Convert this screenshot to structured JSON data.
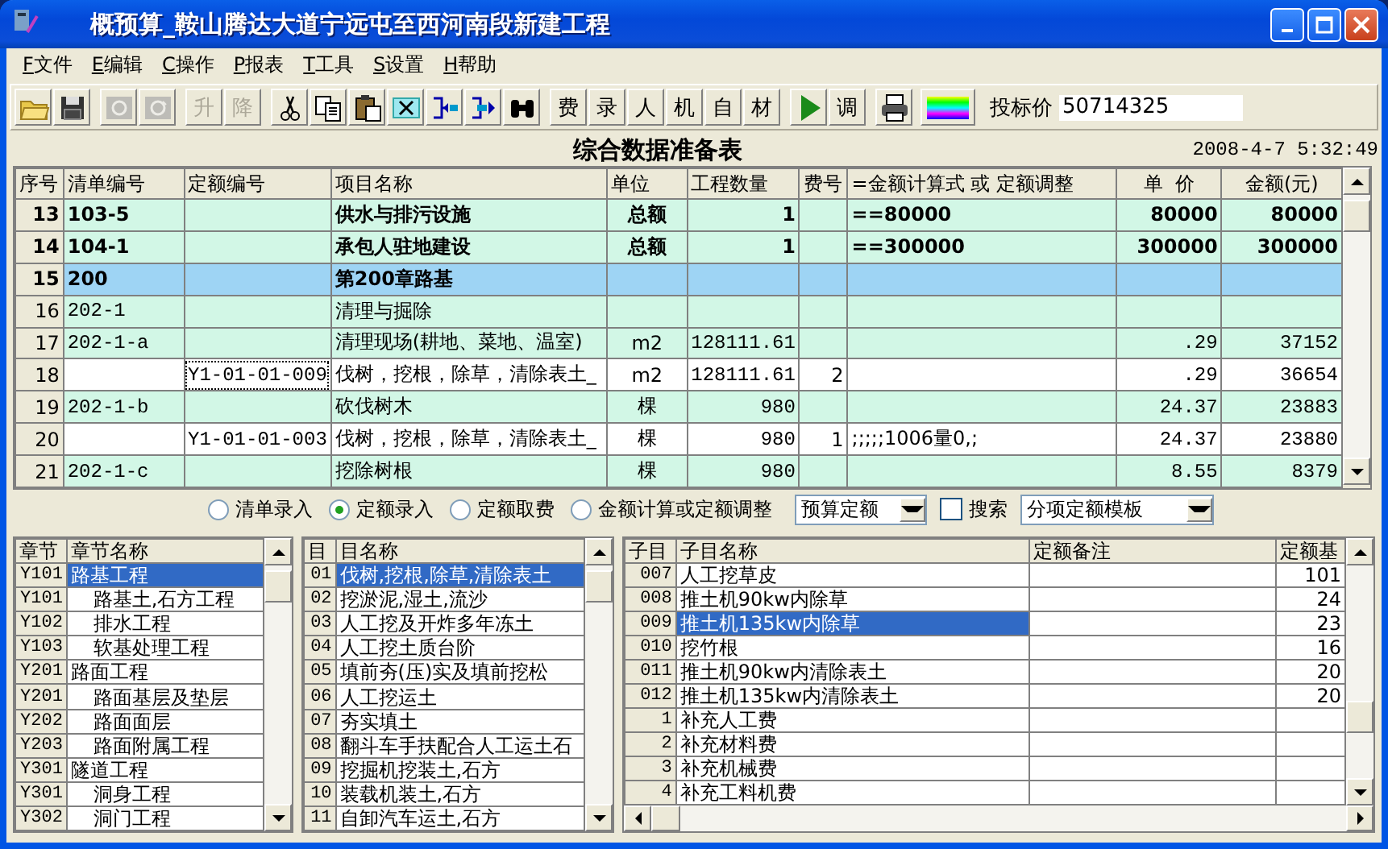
{
  "window": {
    "title": "概预算_鞍山腾达大道宁远屯至西河南段新建工程"
  },
  "menu": [
    {
      "label": "F文件"
    },
    {
      "label": "E编辑"
    },
    {
      "label": "C操作"
    },
    {
      "label": "P报表"
    },
    {
      "label": "T工具"
    },
    {
      "label": "S设置"
    },
    {
      "label": "H帮助"
    }
  ],
  "toolbar": [
    {
      "kind": "icon",
      "disabled": false
    },
    {
      "kind": "icon",
      "disabled": false
    },
    {
      "kind": "icon",
      "disabled": true
    },
    {
      "kind": "icon",
      "disabled": true
    },
    {
      "kind": "text",
      "label": "升",
      "disabled": true
    },
    {
      "kind": "text",
      "label": "降",
      "disabled": true
    },
    {
      "kind": "icon",
      "disabled": false
    },
    {
      "kind": "icon",
      "disabled": false
    },
    {
      "kind": "icon",
      "disabled": false
    },
    {
      "kind": "icon",
      "disabled": false
    },
    {
      "kind": "icon",
      "disabled": false
    },
    {
      "kind": "icon",
      "disabled": false
    },
    {
      "kind": "icon",
      "disabled": false
    },
    {
      "kind": "text",
      "label": "费",
      "disabled": false
    },
    {
      "kind": "text",
      "label": "录",
      "disabled": false
    },
    {
      "kind": "text",
      "label": "人",
      "disabled": false
    },
    {
      "kind": "text",
      "label": "机",
      "disabled": false
    },
    {
      "kind": "text",
      "label": "自",
      "disabled": false
    },
    {
      "kind": "text",
      "label": "材",
      "disabled": false
    },
    {
      "kind": "icon",
      "disabled": false
    },
    {
      "kind": "text",
      "label": "调",
      "disabled": false
    },
    {
      "kind": "icon",
      "disabled": false
    },
    {
      "kind": "icon",
      "disabled": false
    }
  ],
  "bid_price": {
    "label": "投标价",
    "value": "50714325"
  },
  "sheet": {
    "title": "综合数据准备表",
    "timestamp": "2008-4-7 5:32:49"
  },
  "table": {
    "columns": [
      "序号",
      "清单编号",
      "定额编号",
      "项目名称",
      "单位",
      "工程数量",
      "费号",
      "=金额计算式 或 定额调整",
      "单  价",
      "金额(元)"
    ],
    "rows": [
      {
        "kind": "item",
        "focused": false,
        "no": "13",
        "bill_code": "103-5",
        "name": "供水与排污设施",
        "unit": "总额",
        "quantity": "1",
        "formula": "==80000",
        "unit_price": "80000",
        "amount": "80000"
      },
      {
        "kind": "item",
        "focused": false,
        "no": "14",
        "bill_code": "104-1",
        "name": "承包人驻地建设",
        "unit": "总额",
        "quantity": "1",
        "formula": "==300000",
        "unit_price": "300000",
        "amount": "300000"
      },
      {
        "kind": "chapter",
        "focused": false,
        "no": "15",
        "bill_code": "200",
        "name": "第200章路基"
      },
      {
        "kind": "bill",
        "focused": false,
        "no": "16",
        "bill_code": "202-1",
        "name": "清理与掘除"
      },
      {
        "kind": "bill",
        "focused": false,
        "no": "17",
        "bill_code": "202-1-a",
        "name": "清理现场(耕地、菜地、温室)",
        "unit": "m2",
        "quantity": "128111.61",
        "unit_price": ".29",
        "amount": "37152"
      },
      {
        "kind": "quota",
        "focused": true,
        "no": "18",
        "quota_code": "Y1-01-01-009",
        "name": "伐树，挖根，除草，清除表土_",
        "unit": "m2",
        "quantity": "128111.61",
        "fee_no": "2",
        "unit_price": ".29",
        "amount": "36654"
      },
      {
        "kind": "bill",
        "focused": false,
        "no": "19",
        "bill_code": "202-1-b",
        "name": "砍伐树木",
        "unit": "棵",
        "quantity": "980",
        "unit_price": "24.37",
        "amount": "23883"
      },
      {
        "kind": "quota",
        "focused": false,
        "no": "20",
        "quota_code": "Y1-01-01-003",
        "name": "伐树，挖根，除草，清除表土_",
        "unit": "棵",
        "quantity": "980",
        "fee_no": "1",
        "formula": ";;;;;1006量0,;",
        "unit_price": "24.37",
        "amount": "23880"
      },
      {
        "kind": "bill",
        "focused": false,
        "no": "21",
        "bill_code": "202-1-c",
        "name": "挖除树根",
        "unit": "棵",
        "quantity": "980",
        "unit_price": "8.55",
        "amount": "8379"
      }
    ]
  },
  "entry_modes": [
    {
      "label": "清单录入",
      "selected": false
    },
    {
      "label": "定额录入",
      "selected": true
    },
    {
      "label": "定额取费",
      "selected": false
    },
    {
      "label": "金额计算或定额调整",
      "selected": false
    }
  ],
  "quota_book": {
    "value": "预算定额"
  },
  "search": {
    "label": "搜索",
    "checked": false
  },
  "template": {
    "value": "分项定额模板"
  },
  "chapters": {
    "columns": [
      "章节",
      "章节名称"
    ],
    "items": [
      {
        "code": "Y101",
        "name": "路基工程",
        "selected": true,
        "children": [
          {
            "code": "Y101",
            "name": "路基土,石方工程",
            "selected": false
          },
          {
            "code": "Y102",
            "name": "排水工程",
            "selected": false
          },
          {
            "code": "Y103",
            "name": "软基处理工程",
            "selected": false
          }
        ]
      },
      {
        "code": "Y201",
        "name": "路面工程",
        "selected": false,
        "children": [
          {
            "code": "Y201",
            "name": "路面基层及垫层",
            "selected": false
          },
          {
            "code": "Y202",
            "name": "路面面层",
            "selected": false
          },
          {
            "code": "Y203",
            "name": "路面附属工程",
            "selected": false
          }
        ]
      },
      {
        "code": "Y301",
        "name": "隧道工程",
        "selected": false,
        "children": [
          {
            "code": "Y301",
            "name": "洞身工程",
            "selected": false
          },
          {
            "code": "Y302",
            "name": "洞门工程",
            "selected": false
          }
        ]
      }
    ]
  },
  "sections": {
    "columns": [
      "目",
      "目名称"
    ],
    "items": [
      {
        "code": "01",
        "name": "伐树,挖根,除草,清除表土",
        "selected": true
      },
      {
        "code": "02",
        "name": "挖淤泥,湿土,流沙",
        "selected": false
      },
      {
        "code": "03",
        "name": "人工挖及开炸多年冻土",
        "selected": false
      },
      {
        "code": "04",
        "name": "人工挖土质台阶",
        "selected": false
      },
      {
        "code": "05",
        "name": "填前夯(压)实及填前挖松",
        "selected": false
      },
      {
        "code": "06",
        "name": "人工挖运土",
        "selected": false
      },
      {
        "code": "07",
        "name": "夯实填土",
        "selected": false
      },
      {
        "code": "08",
        "name": "翻斗车手扶配合人工运土石",
        "selected": false
      },
      {
        "code": "09",
        "name": "挖掘机挖装土,石方",
        "selected": false
      },
      {
        "code": "10",
        "name": "装载机装土,石方",
        "selected": false
      },
      {
        "code": "11",
        "name": "自卸汽车运土,石方",
        "selected": false
      }
    ]
  },
  "subitems": {
    "columns": [
      "子目",
      "子目名称",
      "定额备注",
      "定额基"
    ],
    "items": [
      {
        "code": "007",
        "name": "人工挖草皮",
        "base": "101",
        "selected": false
      },
      {
        "code": "008",
        "name": "推土机90kw内除草",
        "base": "24",
        "selected": false
      },
      {
        "code": "009",
        "name": "推土机135kw内除草",
        "base": "23",
        "selected": true
      },
      {
        "code": "010",
        "name": "挖竹根",
        "base": "16",
        "selected": false
      },
      {
        "code": "011",
        "name": "推土机90kw内清除表土",
        "base": "20",
        "selected": false
      },
      {
        "code": "012",
        "name": "推土机135kw内清除表土",
        "base": "20",
        "selected": false
      },
      {
        "code": "1",
        "name": "补充人工费",
        "selected": false
      },
      {
        "code": "2",
        "name": "补充材料费",
        "selected": false
      },
      {
        "code": "3",
        "name": "补充机械费",
        "selected": false
      },
      {
        "code": "4",
        "name": "补充工料机费",
        "selected": false
      }
    ]
  }
}
